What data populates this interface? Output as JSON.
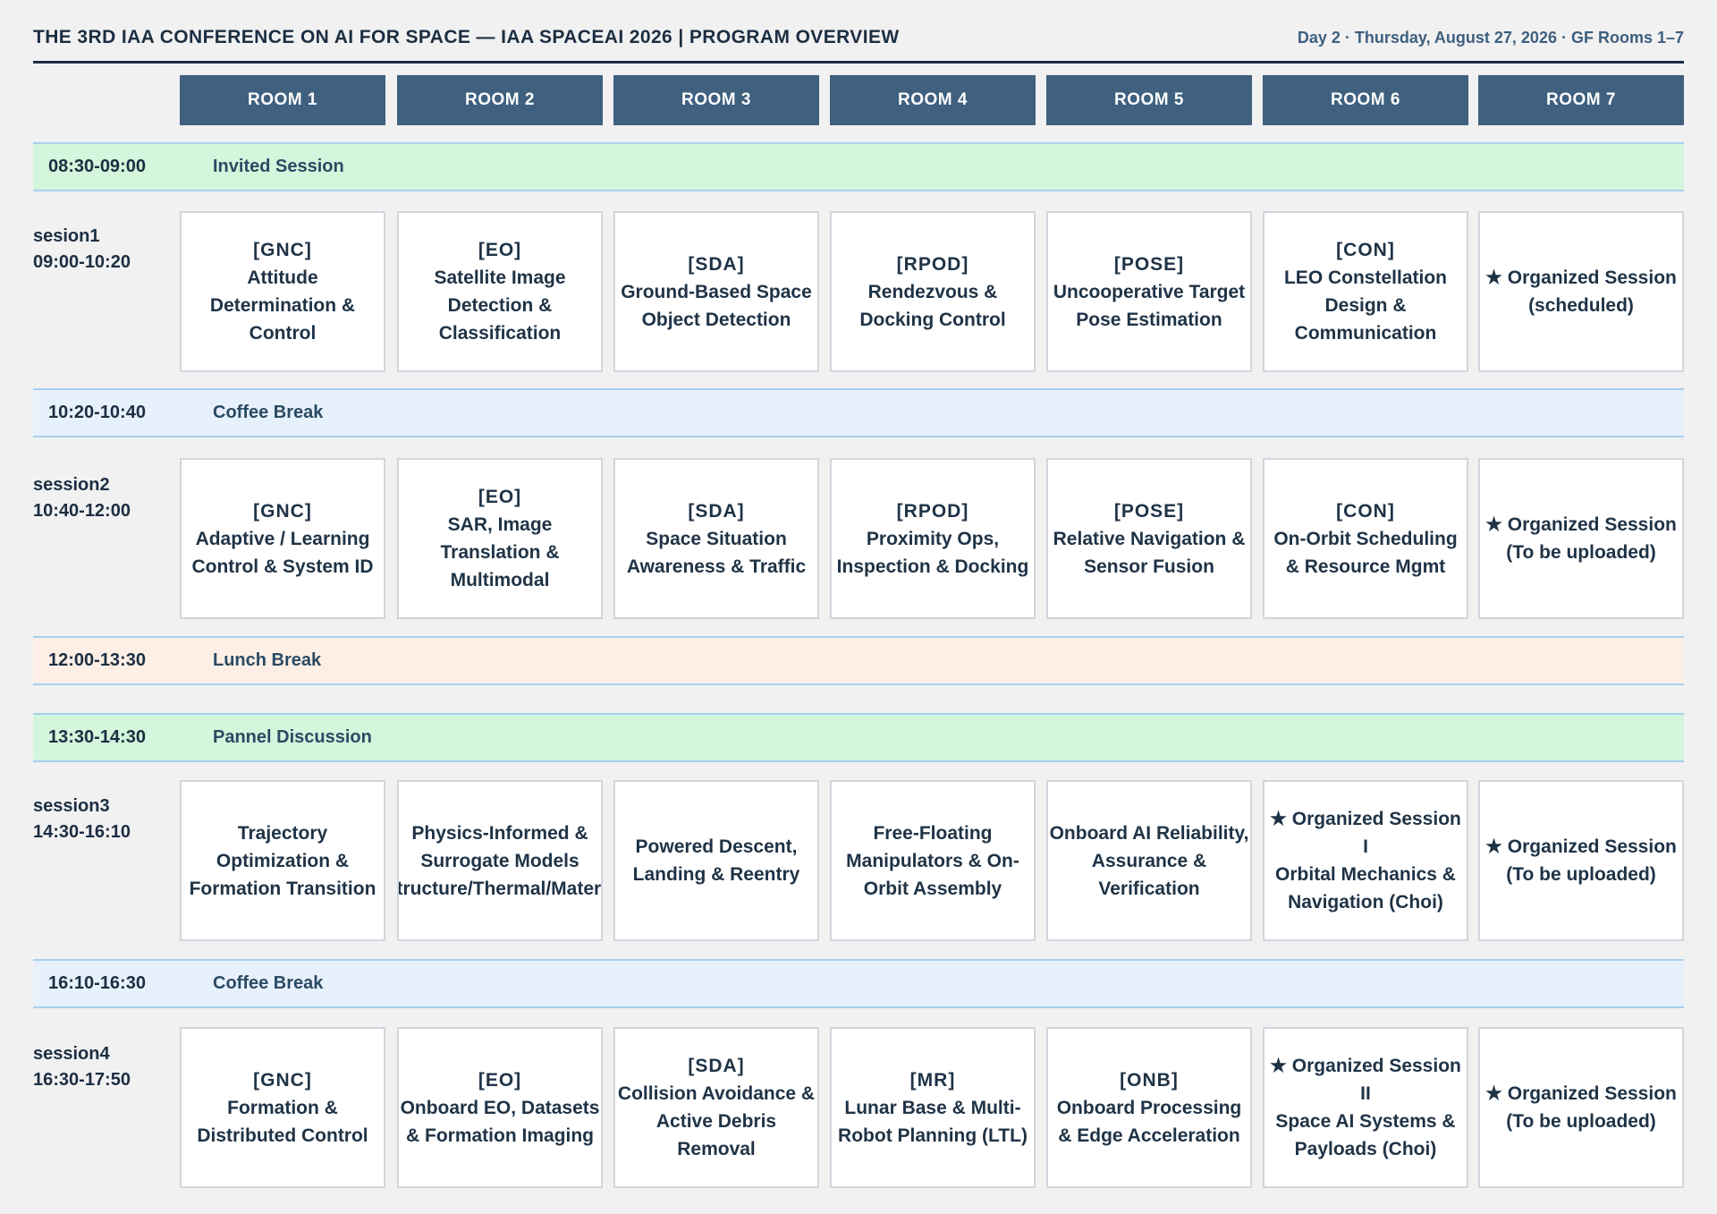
{
  "header": {
    "title": "THE 3RD IAA CONFERENCE ON AI FOR SPACE — IAA SPACEAI 2026  |  PROGRAM OVERVIEW",
    "subtitle": "Day 2 · Thursday, August 27, 2026 · GF Rooms 1–7"
  },
  "rooms": [
    "ROOM 1",
    "ROOM 2",
    "ROOM 3",
    "ROOM 4",
    "ROOM 5",
    "ROOM 6",
    "ROOM 7"
  ],
  "bands": [
    {
      "time": "08:30-09:00",
      "label": "Invited Session",
      "color": "#d3f6dc"
    },
    {
      "time": "10:20-10:40",
      "label": "Coffee Break",
      "color": "#e7f1fc"
    },
    {
      "time": "12:00-13:30",
      "label": "Lunch Break",
      "color": "#fdefe5"
    },
    {
      "time": "13:30-14:30",
      "label": "Pannel Discussion",
      "color": "#d3f6dc"
    },
    {
      "time": "16:10-16:30",
      "label": "Coffee Break",
      "color": "#e7f1fc"
    }
  ],
  "sessions": [
    {
      "name": "sesion1",
      "time": "09:00-10:20",
      "cells": [
        [
          "[GNC]",
          "Attitude",
          "Determination &",
          "Control"
        ],
        [
          "[EO]",
          "Satellite Image",
          "Detection &",
          "Classification"
        ],
        [
          "[SDA]",
          "Ground-Based Space",
          "Object Detection"
        ],
        [
          "[RPOD]",
          "Rendezvous &",
          "Docking Control"
        ],
        [
          "[POSE]",
          "Uncooperative Target",
          "Pose Estimation"
        ],
        [
          "[CON]",
          "LEO Constellation",
          "Design &",
          "Communication"
        ],
        [
          "★ Organized Session",
          "(scheduled)"
        ]
      ]
    },
    {
      "name": "session2",
      "time": "10:40-12:00",
      "cells": [
        [
          "[GNC]",
          "Adaptive / Learning",
          "Control & System ID"
        ],
        [
          "[EO]",
          "SAR, Image",
          "Translation &",
          "Multimodal"
        ],
        [
          "[SDA]",
          "Space Situation",
          "Awareness & Traffic"
        ],
        [
          "[RPOD]",
          "Proximity Ops,",
          "Inspection & Docking"
        ],
        [
          "[POSE]",
          "Relative Navigation &",
          "Sensor Fusion"
        ],
        [
          "[CON]",
          "On-Orbit Scheduling",
          "& Resource Mgmt"
        ],
        [
          "★ Organized Session",
          "(To be uploaded)"
        ]
      ]
    },
    {
      "name": "session3",
      "time": "14:30-16:10",
      "cells": [
        [
          "Trajectory",
          "Optimization &",
          "Formation Transition"
        ],
        [
          "Physics-Informed &",
          "Surrogate Models",
          "(Structure/Thermal/Material"
        ],
        [
          "Powered Descent,",
          "Landing & Reentry"
        ],
        [
          "Free-Floating",
          "Manipulators & On-",
          "Orbit Assembly"
        ],
        [
          "Onboard AI Reliability,",
          "Assurance &",
          "Verification"
        ],
        [
          "★ Organized Session",
          "I",
          "Orbital Mechanics &",
          "Navigation (Choi)"
        ],
        [
          "★ Organized Session",
          "(To be uploaded)"
        ]
      ]
    },
    {
      "name": "session4",
      "time": "16:30-17:50",
      "cells": [
        [
          "[GNC]",
          "Formation &",
          "Distributed Control"
        ],
        [
          "[EO]",
          "Onboard EO, Datasets",
          "& Formation Imaging"
        ],
        [
          "[SDA]",
          "Collision Avoidance &",
          "Active Debris",
          "Removal"
        ],
        [
          "[MR]",
          "Lunar Base & Multi-",
          "Robot Planning (LTL)"
        ],
        [
          "[ONB]",
          "Onboard Processing",
          "& Edge Acceleration"
        ],
        [
          "★ Organized Session",
          "II",
          "Space AI Systems &",
          "Payloads (Choi)"
        ],
        [
          "★ Organized Session",
          "(To be uploaded)"
        ]
      ]
    }
  ]
}
